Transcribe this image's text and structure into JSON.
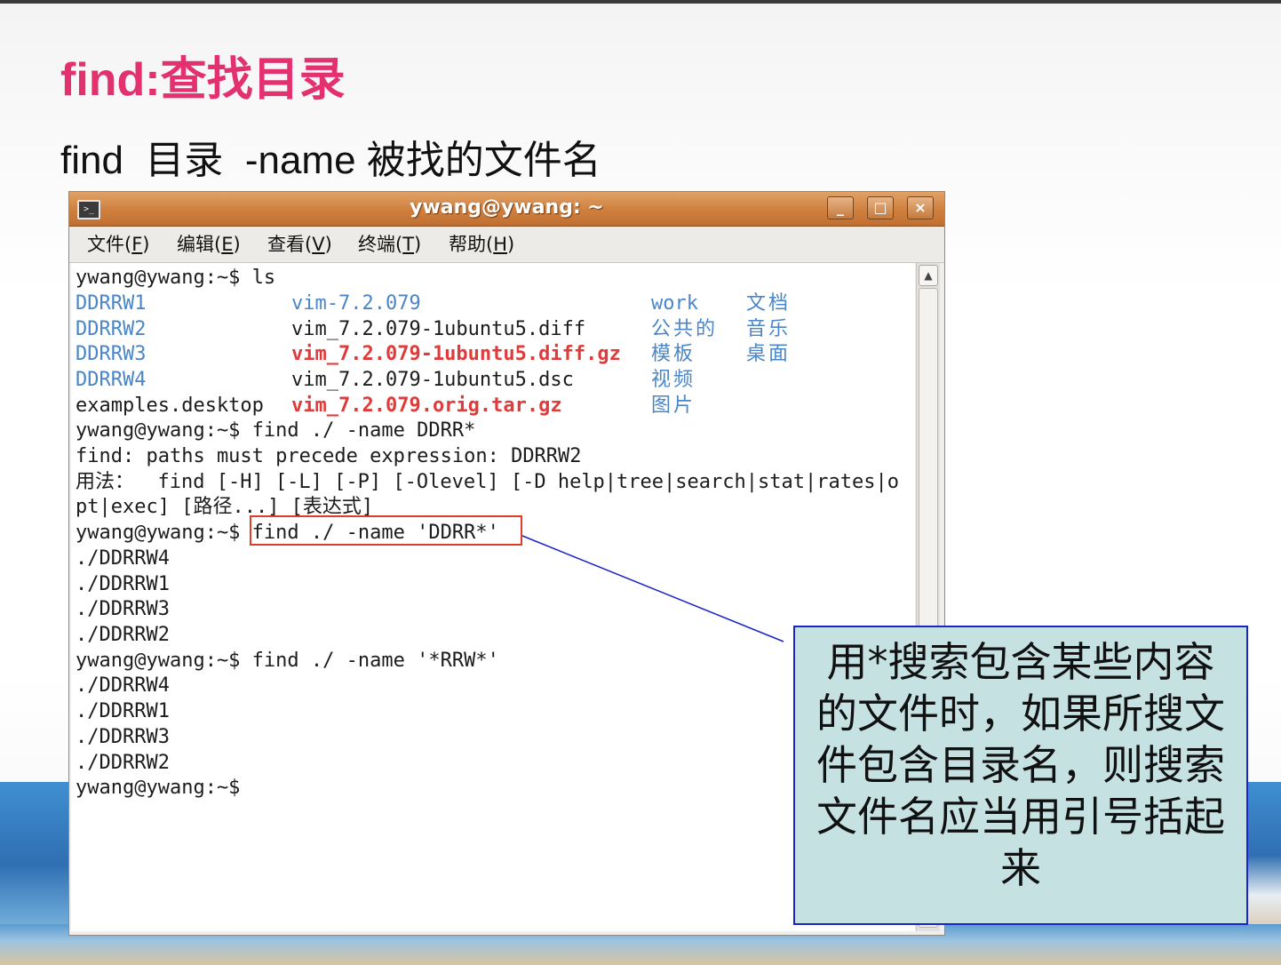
{
  "slide": {
    "title": "find:查找目录",
    "subtitle": "find  目录  -name 被找的文件名"
  },
  "window": {
    "title": "ywang@ywang: ~",
    "icon": "terminal-icon",
    "controls": {
      "minimize": "_",
      "maximize": "□",
      "close": "×"
    },
    "menu": [
      {
        "text": "文件(",
        "acc": "F",
        "end": ")"
      },
      {
        "text": "编辑(",
        "acc": "E",
        "end": ")"
      },
      {
        "text": "查看(",
        "acc": "V",
        "end": ")"
      },
      {
        "text": "终端(",
        "acc": "T",
        "end": ")"
      },
      {
        "text": "帮助(",
        "acc": "H",
        "end": ")"
      }
    ]
  },
  "terminal": {
    "prompt_ls": "ywang@ywang:~$ ls",
    "ls_cols": {
      "col1": [
        "DDRRW1",
        "DDRRW2",
        "DDRRW3",
        "DDRRW4",
        "examples.desktop"
      ],
      "col2": [
        "vim-7.2.079",
        "vim_7.2.079-1ubuntu5.diff",
        "vim_7.2.079-1ubuntu5.diff.gz",
        "vim_7.2.079-1ubuntu5.dsc",
        "vim_7.2.079.orig.tar.gz"
      ],
      "col3": [
        "work",
        "公共的",
        "模板",
        "视频",
        "图片"
      ],
      "col4": [
        "文档",
        "音乐",
        "桌面"
      ]
    },
    "cmd1": "ywang@ywang:~$ find ./ -name DDRR*",
    "err1": "find: paths must precede expression: DDRRW2",
    "usage1": "用法：  find [-H] [-L] [-P] [-Olevel] [-D help|tree|search|stat|rates|o",
    "usage2": "pt|exec] [路径...] [表达式]",
    "cmd2": "ywang@ywang:~$ find ./ -name 'DDRR*'",
    "res2": [
      "./DDRRW4",
      "./DDRRW1",
      "./DDRRW3",
      "./DDRRW2"
    ],
    "cmd3": "ywang@ywang:~$ find ./ -name '*RRW*'",
    "res3": [
      "./DDRRW4",
      "./DDRRW1",
      "./DDRRW3",
      "./DDRRW2"
    ],
    "final_prompt": "ywang@ywang:~$"
  },
  "callout": {
    "text": "用*搜索包含某些内容的文件时，如果所搜文件包含目录名，则搜索文件名应当用引号括起来"
  },
  "colors": {
    "title": "#e3306e",
    "titlebar": "#cf7f3e",
    "dir_blue": "#4a86c8",
    "archive_red": "#e03a3a",
    "callout_bg": "#c5e1e2",
    "callout_border": "#1a24c8",
    "highlight": "#e03c2c"
  }
}
